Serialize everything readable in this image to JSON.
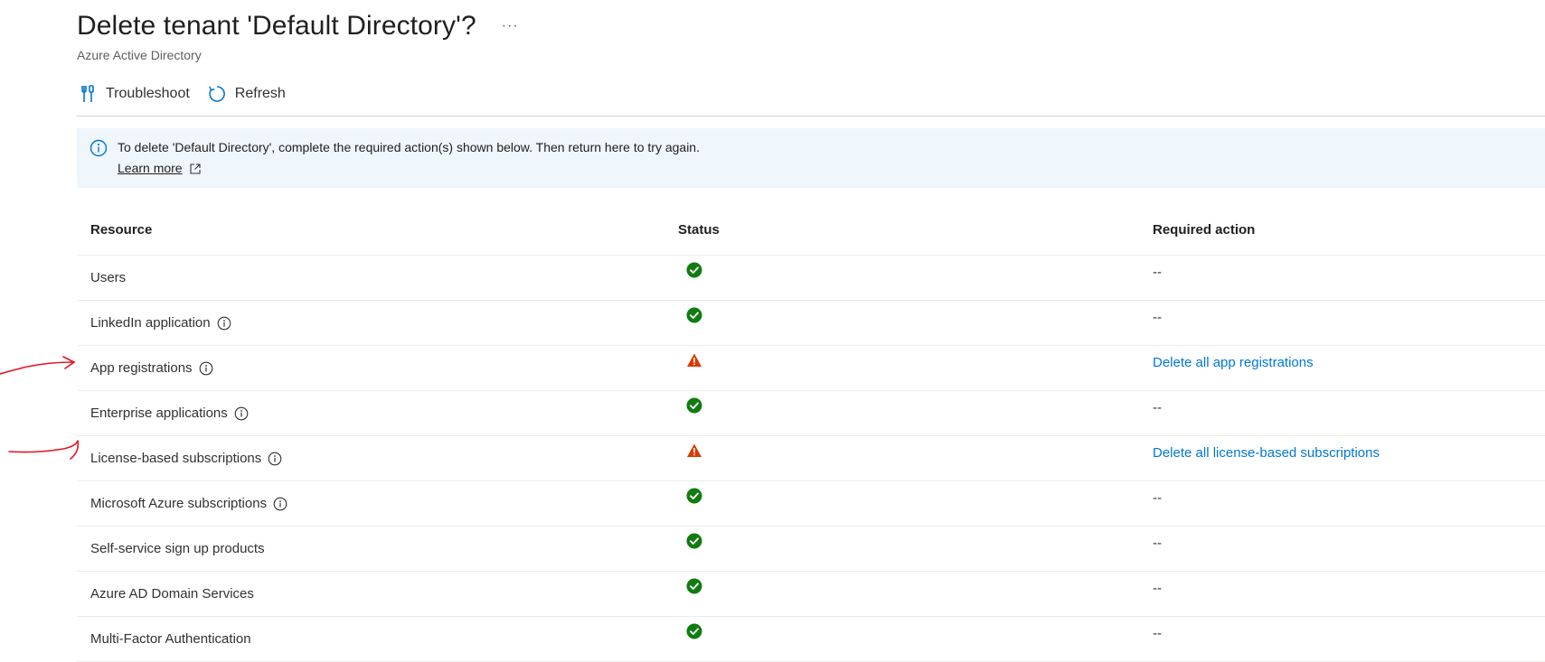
{
  "header": {
    "title": "Delete tenant 'Default Directory'?",
    "more_label": "···",
    "subtitle": "Azure Active Directory"
  },
  "toolbar": {
    "troubleshoot_label": "Troubleshoot",
    "refresh_label": "Refresh"
  },
  "banner": {
    "message": "To delete 'Default Directory', complete the required action(s) shown below. Then return here to try again.",
    "learn_more": "Learn more"
  },
  "table": {
    "columns": {
      "resource": "Resource",
      "status": "Status",
      "action": "Required action"
    },
    "rows": [
      {
        "resource": "Users",
        "info": false,
        "status": "success",
        "action": "--",
        "action_link": false
      },
      {
        "resource": "LinkedIn application",
        "info": true,
        "status": "success",
        "action": "--",
        "action_link": false
      },
      {
        "resource": "App registrations",
        "info": true,
        "status": "warning",
        "action": "Delete all app registrations",
        "action_link": true
      },
      {
        "resource": "Enterprise applications",
        "info": true,
        "status": "success",
        "action": "--",
        "action_link": false
      },
      {
        "resource": "License-based subscriptions",
        "info": true,
        "status": "warning",
        "action": "Delete all license-based subscriptions",
        "action_link": true
      },
      {
        "resource": "Microsoft Azure subscriptions",
        "info": true,
        "status": "success",
        "action": "--",
        "action_link": false
      },
      {
        "resource": "Self-service sign up products",
        "info": false,
        "status": "success",
        "action": "--",
        "action_link": false
      },
      {
        "resource": "Azure AD Domain Services",
        "info": false,
        "status": "success",
        "action": "--",
        "action_link": false
      },
      {
        "resource": "Multi-Factor Authentication",
        "info": false,
        "status": "success",
        "action": "--",
        "action_link": false
      }
    ]
  },
  "colors": {
    "success": "#107c10",
    "warning": "#d83b01",
    "link": "#0078d4",
    "banner_bg": "#eff6fc",
    "annotation": "#e81123"
  },
  "icons": {
    "troubleshoot": "troubleshoot-icon",
    "refresh": "refresh-icon",
    "info": "info-icon",
    "external_link": "external-link-icon",
    "success": "success-check-icon",
    "warning": "warning-triangle-icon"
  }
}
